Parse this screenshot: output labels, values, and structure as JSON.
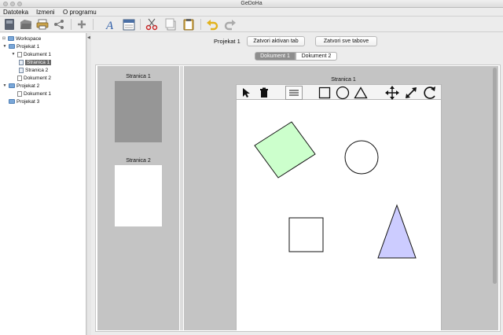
{
  "window": {
    "title": "GeDoHa"
  },
  "menu": [
    "Datoteka",
    "Izmeni",
    "O programu"
  ],
  "toolbar_icons": [
    "save-icon",
    "open-icon",
    "print-icon",
    "share-icon",
    "add-icon",
    "font-icon",
    "calendar-icon",
    "cut-icon",
    "copy-icon",
    "paste-icon",
    "undo-icon",
    "redo-icon"
  ],
  "tree": {
    "root": "Workspace",
    "nodes": [
      {
        "label": "Workspace",
        "kind": "folder",
        "level": 0,
        "toggle": "⊟"
      },
      {
        "label": "Projekat 1",
        "kind": "folder",
        "level": 1,
        "toggle": "▼"
      },
      {
        "label": "Dokument 1",
        "kind": "doc",
        "level": 2,
        "toggle": "▼"
      },
      {
        "label": "Stranica 1",
        "kind": "page",
        "level": 3,
        "toggle": "",
        "selected": true
      },
      {
        "label": "Stranica 2",
        "kind": "page",
        "level": 3,
        "toggle": ""
      },
      {
        "label": "Dokument 2",
        "kind": "doc",
        "level": 2,
        "toggle": ""
      },
      {
        "label": "Projekat 2",
        "kind": "folder",
        "level": 1,
        "toggle": "▼"
      },
      {
        "label": "Dokument 1",
        "kind": "doc",
        "level": 2,
        "toggle": ""
      },
      {
        "label": "Projekat 3",
        "kind": "folder",
        "level": 1,
        "toggle": ""
      }
    ]
  },
  "main": {
    "project_label": "Projekat 1",
    "close_active_tab": "Zatvori aktivan tab",
    "close_all_tabs": "Zatvori sve tabove",
    "tabs": [
      {
        "label": "Dokument 1",
        "active": true
      },
      {
        "label": "Dokument 2",
        "active": false
      }
    ],
    "thumbnails": [
      {
        "label": "Stranica 1",
        "color": "#969696"
      },
      {
        "label": "Stranica 2",
        "color": "#ffffff"
      }
    ],
    "page_title": "Stranica 1",
    "shape_tools": [
      "pointer-icon",
      "delete-icon",
      "list-icon",
      "rectangle-icon",
      "circle-icon",
      "triangle-icon",
      "move-icon",
      "resize-icon",
      "rotate-icon"
    ]
  },
  "shapes": [
    {
      "type": "rotated-rectangle",
      "fill": "#ccffcc"
    },
    {
      "type": "circle",
      "fill": "#ffffff"
    },
    {
      "type": "square",
      "fill": "#ffffff"
    },
    {
      "type": "triangle",
      "fill": "#ccccff"
    }
  ]
}
